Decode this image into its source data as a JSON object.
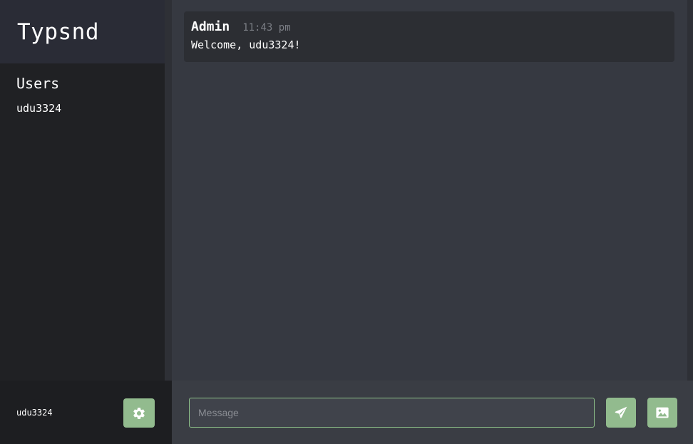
{
  "app": {
    "title": "Typsnd"
  },
  "sidebar": {
    "users_heading": "Users",
    "users": [
      "udu3324"
    ]
  },
  "messages": [
    {
      "author": "Admin",
      "time": "11:43 pm",
      "text": "Welcome, udu3324!"
    }
  ],
  "footer": {
    "current_user": "udu3324",
    "settings_icon": "gear-icon"
  },
  "composer": {
    "placeholder": "Message",
    "value": "",
    "send_icon": "paper-plane-icon",
    "image_icon": "image-icon"
  },
  "colors": {
    "accent": "#92bb8e",
    "input_border": "#8fc38b",
    "sidebar_bg": "#202124",
    "brand_bg": "#2a2c36",
    "chat_bg": "#363941",
    "message_bg": "#2c2e33"
  }
}
